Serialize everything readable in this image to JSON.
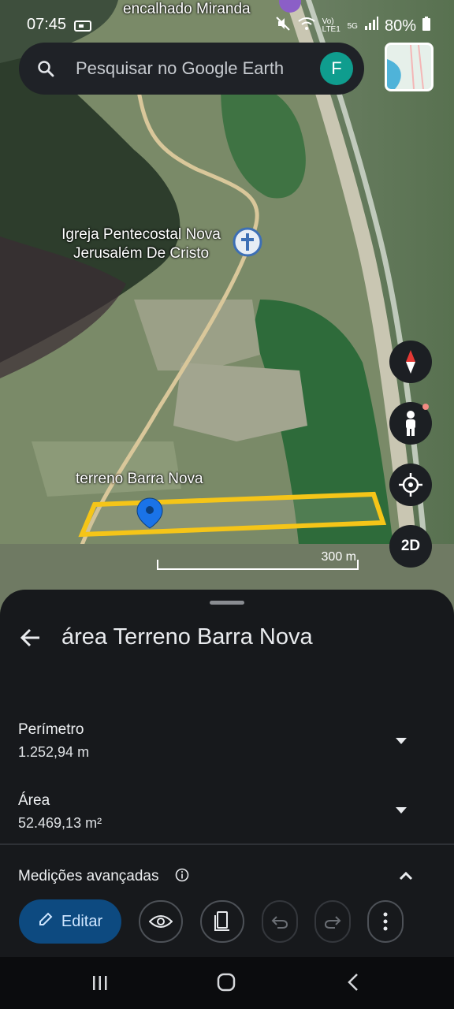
{
  "status_bar": {
    "time": "07:45",
    "battery": "80%",
    "lte_label": "Vo) LTE1",
    "network_label": "5G"
  },
  "search": {
    "placeholder": "Pesquisar no Google Earth",
    "avatar_letter": "F"
  },
  "map": {
    "labels": {
      "top_place": "encalhado Miranda",
      "church_line1": "Igreja Pentecostal Nova",
      "church_line2": "Jerusalém De Cristo",
      "terreno": "terreno Barra Nova"
    },
    "scale_label": "300 m",
    "polygon_color": "#f5c518"
  },
  "controls": {
    "mode_label": "2D"
  },
  "sheet": {
    "title": "área Terreno Barra Nova",
    "perimetro_label": "Perímetro",
    "perimetro_value": "1.252,94 m",
    "area_label": "Área",
    "area_value": "52.469,13 m²",
    "advanced_label": "Medições avançadas"
  },
  "toolbar": {
    "edit_label": "Editar"
  },
  "colors": {
    "accent": "#0d4a80",
    "sheet_bg": "#17191c"
  }
}
